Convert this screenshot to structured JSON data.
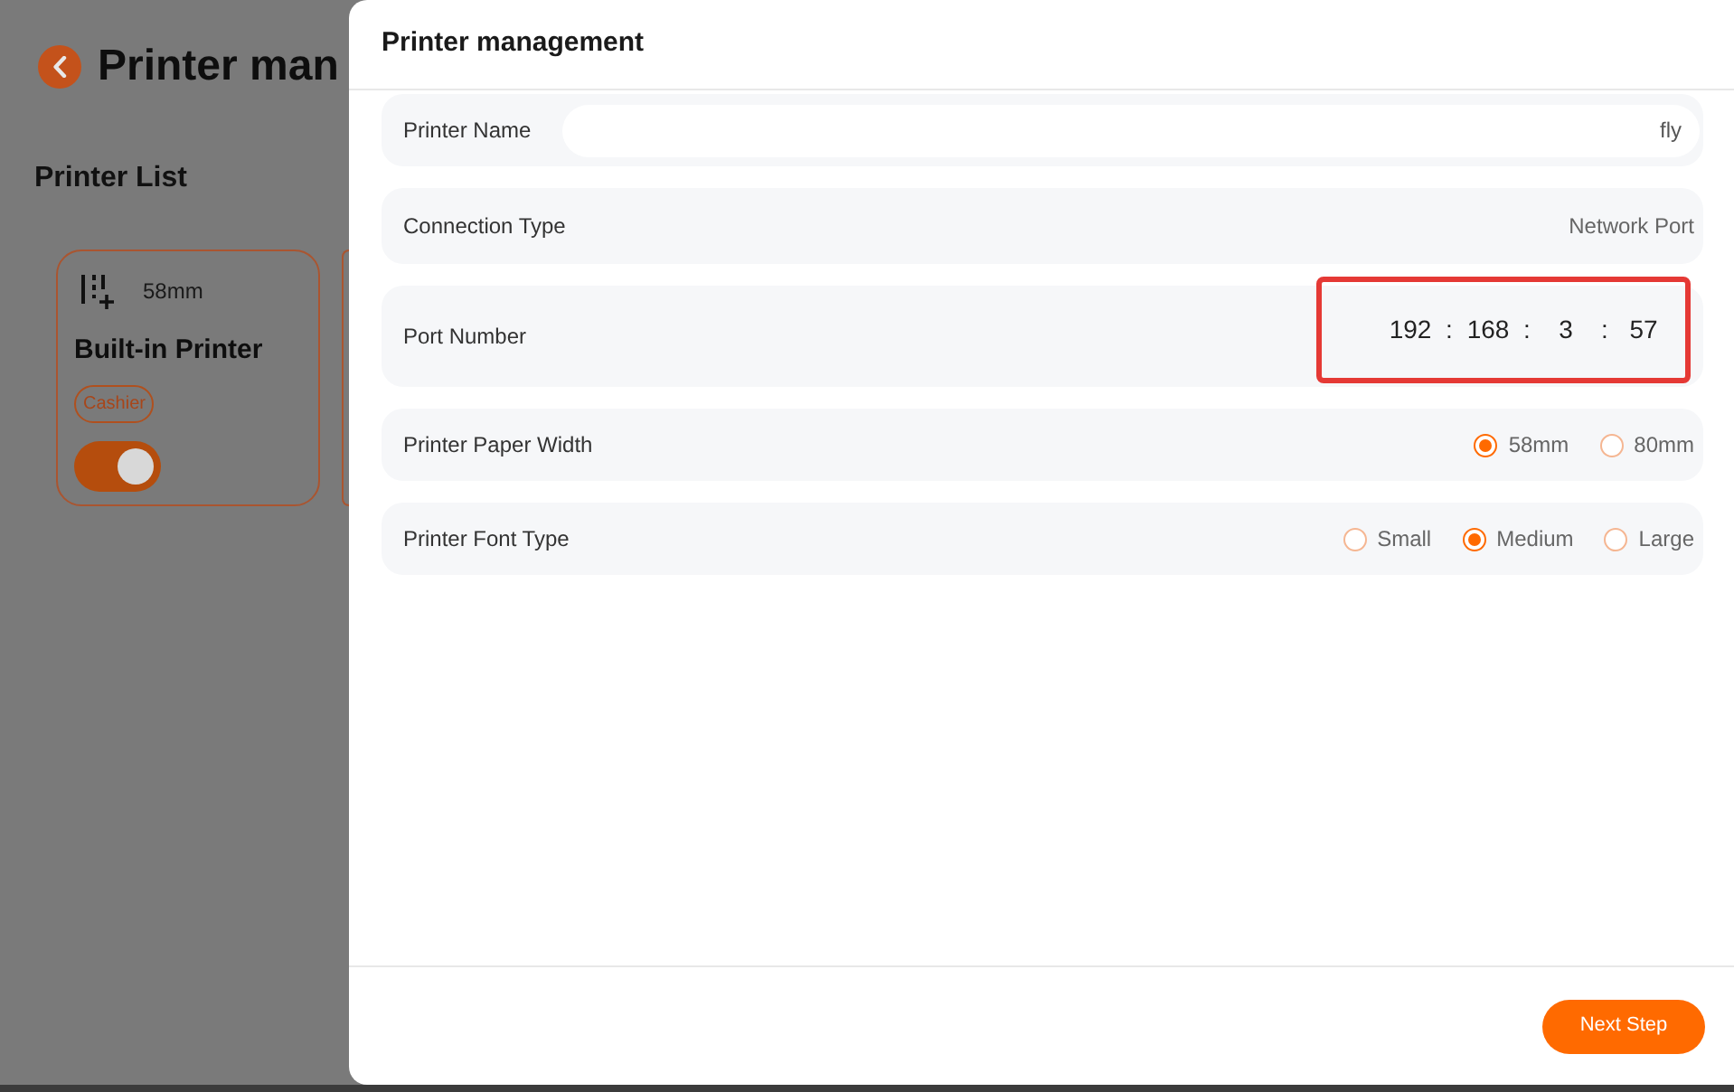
{
  "page": {
    "title": "Printer man",
    "section_title": "Printer List",
    "printers": [
      {
        "paper_width": "58mm",
        "name": "Built-in Printer",
        "tag": "Cashier",
        "on": true
      }
    ]
  },
  "dialog": {
    "title": "Printer management",
    "fields": [
      {
        "kind": "input",
        "label": "Printer Name",
        "value": "fly"
      },
      {
        "kind": "text",
        "label": "Connection Type",
        "value": "Network Port"
      },
      {
        "kind": "ip",
        "label": "Port Number",
        "segments": [
          "192",
          "168",
          "3",
          "57"
        ],
        "separators": [
          ":",
          ":",
          ":"
        ],
        "highlighted": true
      },
      {
        "kind": "radio",
        "label": "Printer Paper Width",
        "options": [
          {
            "label": "58mm",
            "selected": true
          },
          {
            "label": "80mm",
            "selected": false
          }
        ]
      },
      {
        "kind": "radio",
        "label": "Printer Font Type",
        "options": [
          {
            "label": "Small",
            "selected": false
          },
          {
            "label": "Medium",
            "selected": true
          },
          {
            "label": "Large",
            "selected": false
          }
        ]
      }
    ],
    "next_button": "Next Step"
  }
}
